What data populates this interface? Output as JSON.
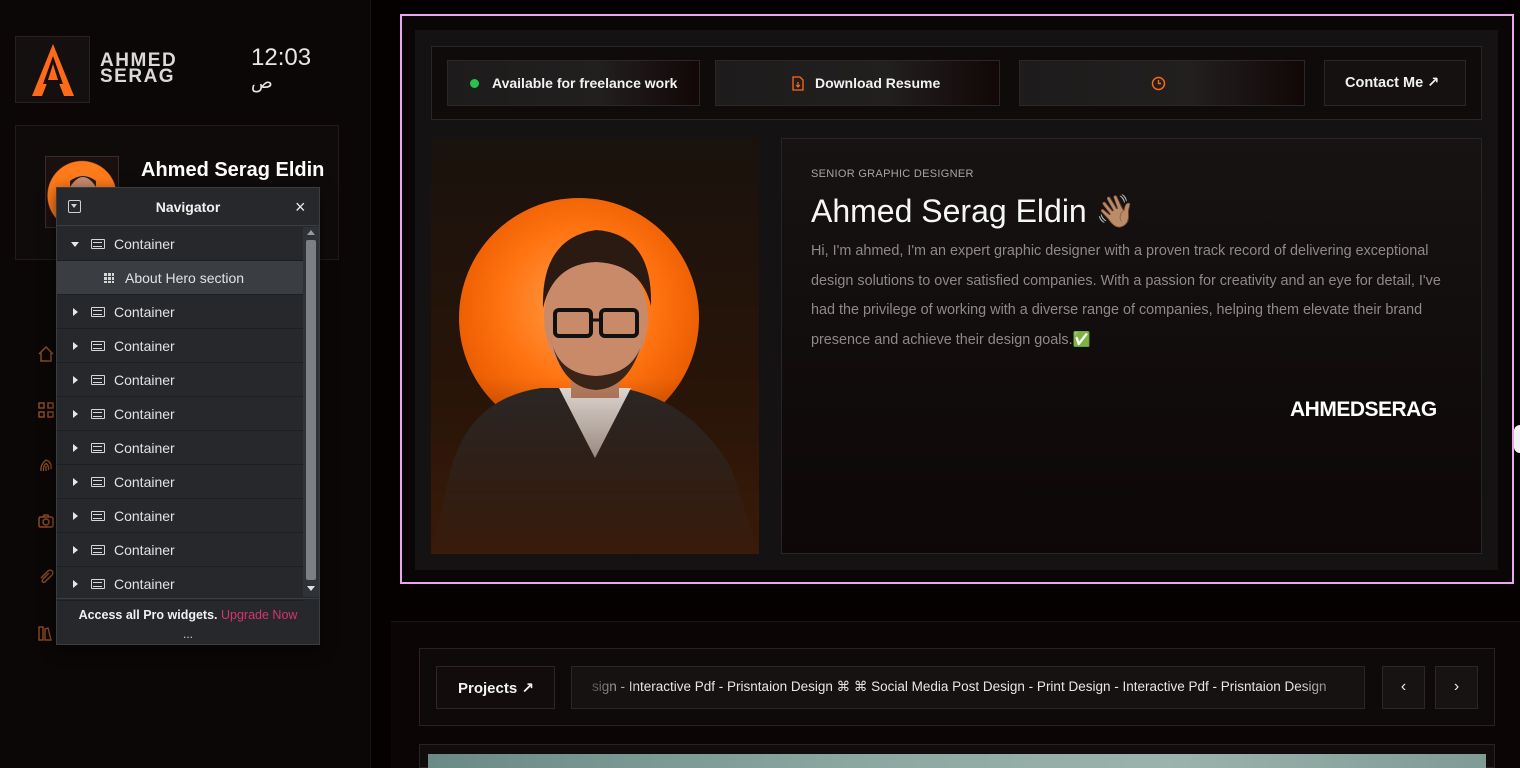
{
  "sidebar": {
    "brand_line1": "AHMED",
    "brand_line2": "SERAG",
    "clock_time": "12:03",
    "clock_period": "ص",
    "profile_name": "Ahmed Serag Eldin",
    "nav_icons": [
      "home-icon",
      "grid-icon",
      "fingerprint-icon",
      "camera-icon",
      "paperclip-icon",
      "books-icon"
    ]
  },
  "navigator": {
    "title": "Navigator",
    "rows": [
      {
        "label": "Container",
        "expanded": true
      },
      {
        "label": "About Hero section",
        "child": true,
        "selected": true
      },
      {
        "label": "Container"
      },
      {
        "label": "Container"
      },
      {
        "label": "Container"
      },
      {
        "label": "Container"
      },
      {
        "label": "Container"
      },
      {
        "label": "Container"
      },
      {
        "label": "Container"
      },
      {
        "label": "Container"
      },
      {
        "label": "Container"
      }
    ],
    "footer_text": "Access all Pro widgets.",
    "footer_link": "Upgrade Now",
    "more": "..."
  },
  "topbar": {
    "availability": "Available for freelance work",
    "download": "Download Resume",
    "contact": "Contact Me ↗"
  },
  "hero": {
    "role": "SENIOR GRAPHIC DESIGNER",
    "name": "Ahmed Serag Eldin 👋🏽",
    "bio": "Hi, I'm ahmed, I'm an expert graphic designer with a proven track record of delivering exceptional design solutions to over satisfied companies. With a passion for creativity and an eye for detail, I've had the privilege of working with a diverse range of companies, helping them elevate their brand presence and achieve their design goals.✅",
    "signature": "AHMEDSERAG"
  },
  "projects": {
    "button": "Projects ↗",
    "marquee": "sign - Interactive Pdf - Prisntaion Design ⌘ ⌘ Social Media Post Design - Print Design - Interactive Pdf - Prisntaion Design",
    "prev": "‹",
    "next": "›"
  },
  "colors": {
    "accent": "#ff6a1a",
    "selection_outline": "#e9a7f0",
    "upgrade_link": "#d8326e",
    "available_dot": "#27c24c"
  }
}
